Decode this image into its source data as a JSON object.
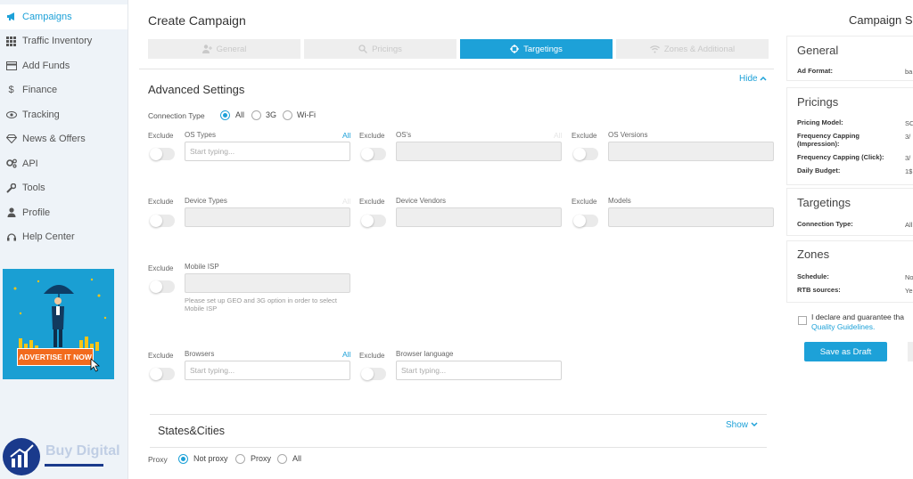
{
  "sidebar": {
    "items": [
      {
        "label": "Campaigns",
        "icon": "megaphone-icon",
        "active": true
      },
      {
        "label": "Traffic Inventory",
        "icon": "grid-icon"
      },
      {
        "label": "Add Funds",
        "icon": "card-icon"
      },
      {
        "label": "Finance",
        "icon": "dollar-icon"
      },
      {
        "label": "Tracking",
        "icon": "eye-icon"
      },
      {
        "label": "News & Offers",
        "icon": "diamond-icon"
      },
      {
        "label": "API",
        "icon": "gears-icon"
      },
      {
        "label": "Tools",
        "icon": "wrench-icon"
      },
      {
        "label": "Profile",
        "icon": "user-icon"
      },
      {
        "label": "Help Center",
        "icon": "headset-icon"
      }
    ],
    "banner_text": "ADVERTISE IT NOW",
    "logo_text": "Buy Digital"
  },
  "header": {
    "title": "Create Campaign"
  },
  "steps": [
    {
      "label": "General",
      "icon": "user-plus-icon"
    },
    {
      "label": "Pricings",
      "icon": "search-icon"
    },
    {
      "label": "Targetings",
      "icon": "target-icon",
      "active": true
    },
    {
      "label": "Zones & Additional",
      "icon": "wifi-icon"
    }
  ],
  "advanced": {
    "title": "Advanced Settings",
    "hide_label": "Hide",
    "connection_label": "Connection Type",
    "connection_options": [
      "All",
      "3G",
      "Wi-Fi"
    ],
    "connection_selected": "All",
    "exclude_label": "Exclude",
    "fields": {
      "os_types": {
        "label": "OS Types",
        "placeholder": "Start typing...",
        "all": "All"
      },
      "oss": {
        "label": "OS's"
      },
      "os_versions": {
        "label": "OS Versions"
      },
      "device_types": {
        "label": "Device Types"
      },
      "device_vendors": {
        "label": "Device Vendors"
      },
      "models": {
        "label": "Models"
      },
      "mobile_isp": {
        "label": "Mobile ISP",
        "note": "Please set up GEO and 3G option in order to select Mobile ISP"
      },
      "browsers": {
        "label": "Browsers",
        "placeholder": "Start typing...",
        "all": "All"
      },
      "browser_language": {
        "label": "Browser language",
        "placeholder": "Start typing..."
      }
    }
  },
  "states": {
    "title": "States&Cities",
    "show_label": "Show",
    "proxy_label": "Proxy",
    "proxy_options": [
      "Not proxy",
      "Proxy",
      "All"
    ],
    "proxy_selected": "Not proxy"
  },
  "summary": {
    "title": "Campaign S",
    "general": {
      "title": "General",
      "ad_format_k": "Ad Format:",
      "ad_format_v": "ba"
    },
    "pricings": {
      "title": "Pricings",
      "model_k": "Pricing Model:",
      "model_v": "SC",
      "cap_imp_k": "Frequency Capping (Impression):",
      "cap_imp_v": "3/",
      "cap_click_k": "Frequency Capping (Click):",
      "cap_click_v": "3/",
      "budget_k": "Daily Budget:",
      "budget_v": "1$"
    },
    "targetings": {
      "title": "Targetings",
      "conn_k": "Connection Type:",
      "conn_v": "All"
    },
    "zones": {
      "title": "Zones",
      "schedule_k": "Schedule:",
      "schedule_v": "No",
      "rtb_k": "RTB sources:",
      "rtb_v": "Ye"
    },
    "declare_text": "I declare and guarantee tha",
    "quality_link": "Quality Guidelines.",
    "save_draft": "Save as Draft"
  },
  "colors": {
    "accent": "#1da1d8",
    "sidebar_bg": "#eef3f8",
    "banner_bg": "#1a9fd3",
    "banner_button": "#f26b1d"
  }
}
